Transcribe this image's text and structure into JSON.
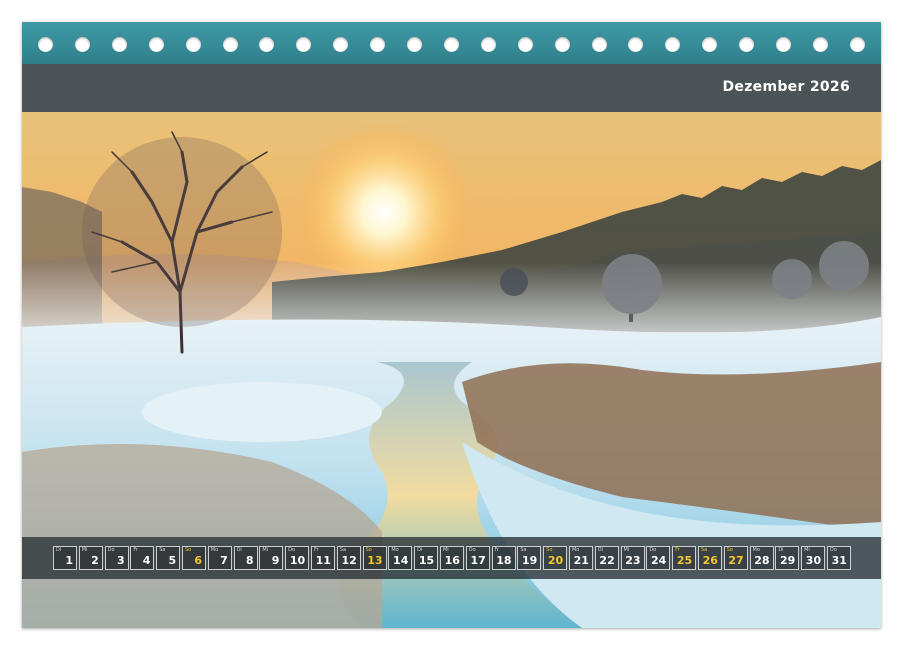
{
  "calendar": {
    "month_title": "Dezember 2026",
    "image_description_icon": "winter-sunrise-landscape-image",
    "accent_color": "#f2c72c",
    "spiral_color": "#3e9aa6",
    "title_bar_color": "#4a5355",
    "days": [
      {
        "weekday": "Di",
        "day": "1",
        "weekend": false
      },
      {
        "weekday": "Mi",
        "day": "2",
        "weekend": false
      },
      {
        "weekday": "Do",
        "day": "3",
        "weekend": false
      },
      {
        "weekday": "Fr",
        "day": "4",
        "weekend": false
      },
      {
        "weekday": "Sa",
        "day": "5",
        "weekend": false
      },
      {
        "weekday": "So",
        "day": "6",
        "weekend": true
      },
      {
        "weekday": "Mo",
        "day": "7",
        "weekend": false
      },
      {
        "weekday": "Di",
        "day": "8",
        "weekend": false
      },
      {
        "weekday": "Mi",
        "day": "9",
        "weekend": false
      },
      {
        "weekday": "Do",
        "day": "10",
        "weekend": false
      },
      {
        "weekday": "Fr",
        "day": "11",
        "weekend": false
      },
      {
        "weekday": "Sa",
        "day": "12",
        "weekend": false
      },
      {
        "weekday": "So",
        "day": "13",
        "weekend": true
      },
      {
        "weekday": "Mo",
        "day": "14",
        "weekend": false
      },
      {
        "weekday": "Di",
        "day": "15",
        "weekend": false
      },
      {
        "weekday": "Mi",
        "day": "16",
        "weekend": false
      },
      {
        "weekday": "Do",
        "day": "17",
        "weekend": false
      },
      {
        "weekday": "Fr",
        "day": "18",
        "weekend": false
      },
      {
        "weekday": "Sa",
        "day": "19",
        "weekend": false
      },
      {
        "weekday": "So",
        "day": "20",
        "weekend": true
      },
      {
        "weekday": "Mo",
        "day": "21",
        "weekend": false
      },
      {
        "weekday": "Di",
        "day": "22",
        "weekend": false
      },
      {
        "weekday": "Mi",
        "day": "23",
        "weekend": false
      },
      {
        "weekday": "Do",
        "day": "24",
        "weekend": false
      },
      {
        "weekday": "Fr",
        "day": "25",
        "weekend": true
      },
      {
        "weekday": "Sa",
        "day": "26",
        "weekend": true
      },
      {
        "weekday": "So",
        "day": "27",
        "weekend": true
      },
      {
        "weekday": "Mo",
        "day": "28",
        "weekend": false
      },
      {
        "weekday": "Di",
        "day": "29",
        "weekend": false
      },
      {
        "weekday": "Mi",
        "day": "30",
        "weekend": false
      },
      {
        "weekday": "Do",
        "day": "31",
        "weekend": false
      }
    ]
  }
}
